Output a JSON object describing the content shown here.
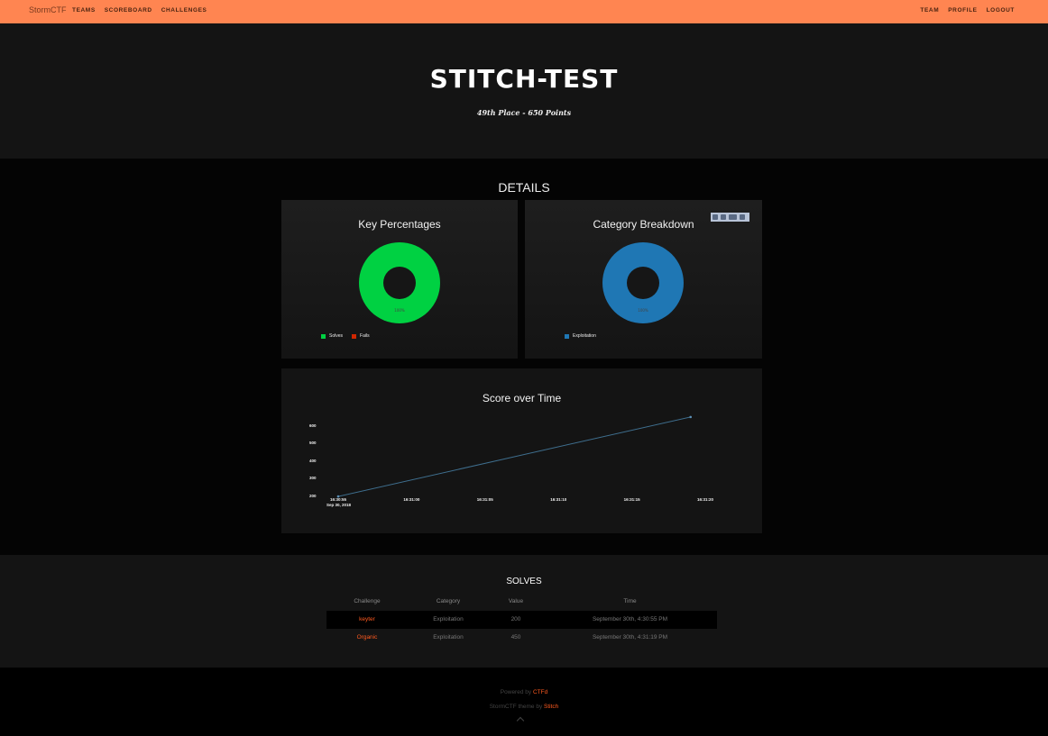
{
  "navbar": {
    "brand": "StormCTF",
    "left": [
      "TEAMS",
      "SCOREBOARD",
      "CHALLENGES"
    ],
    "right": [
      "TEAM",
      "PROFILE",
      "LOGOUT"
    ],
    "color": "#ff8551"
  },
  "hero": {
    "team_name": "STITCH-TEST",
    "place": "49th Place - 650 Points"
  },
  "details": {
    "title": "DETAILS",
    "key_percentages": {
      "title": "Key Percentages",
      "center_label": "100%",
      "legend": [
        {
          "label": "Solves",
          "color": "#00d142"
        },
        {
          "label": "Fails",
          "color": "#cf2600"
        }
      ]
    },
    "category_breakdown": {
      "title": "Category Breakdown",
      "center_label": "100%",
      "legend": [
        {
          "label": "Exploitation",
          "color": "#1f77b4"
        }
      ]
    },
    "score_over_time": {
      "title": "Score over Time"
    }
  },
  "chart_data": [
    {
      "type": "pie",
      "title": "Key Percentages",
      "categories": [
        "Solves",
        "Fails"
      ],
      "values": [
        100,
        0
      ]
    },
    {
      "type": "pie",
      "title": "Category Breakdown",
      "categories": [
        "Exploitation"
      ],
      "values": [
        100
      ]
    },
    {
      "type": "line",
      "title": "Score over Time",
      "x": [
        "16:30:55",
        "16:31:19"
      ],
      "y": [
        200,
        650
      ],
      "x_ticks": [
        "16:30:55",
        "16:31:00",
        "16:31:05",
        "16:31:10",
        "16:31:15",
        "16:31:20"
      ],
      "x_date_label": "Sep 30, 2018",
      "y_ticks": [
        "200",
        "300",
        "400",
        "500",
        "600"
      ],
      "ylim": [
        180,
        680
      ]
    }
  ],
  "solves": {
    "title": "SOLVES",
    "headers": [
      "Challenge",
      "Category",
      "Value",
      "Time"
    ],
    "rows": [
      {
        "challenge": "keyter",
        "category": "Exploitation",
        "value": "200",
        "time": "September 30th, 4:30:55 PM"
      },
      {
        "challenge": "Organic",
        "category": "Exploitation",
        "value": "450",
        "time": "September 30th, 4:31:19 PM"
      }
    ]
  },
  "footer": {
    "powered_prefix": "Powered by ",
    "powered_link": "CTFd",
    "theme_prefix": "StormCTF theme by ",
    "theme_link": "Stitch"
  }
}
